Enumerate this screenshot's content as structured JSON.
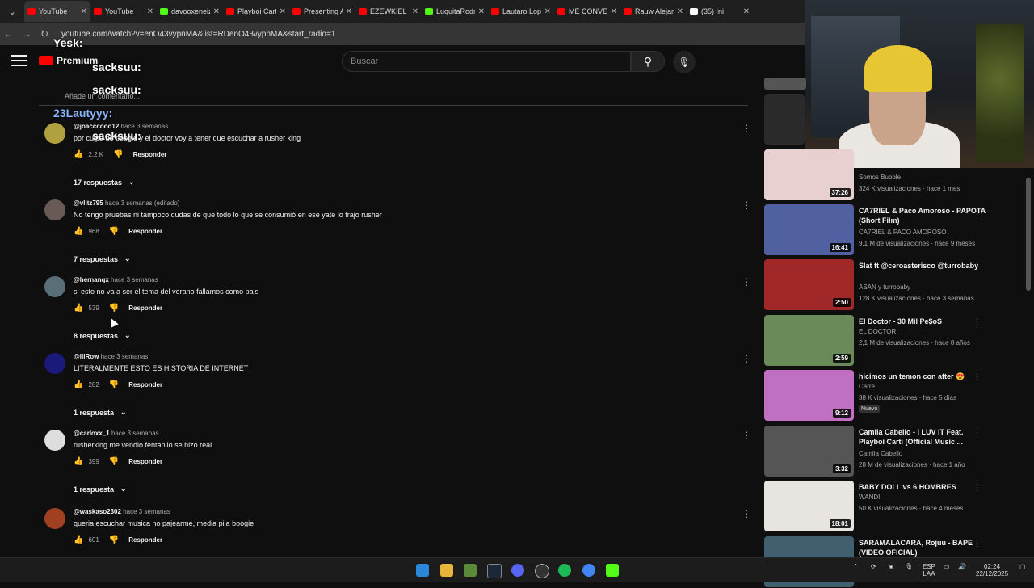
{
  "browser": {
    "tabs": [
      {
        "title": "YouTube",
        "color": "#ff0000"
      },
      {
        "title": "YouTube",
        "color": "#ff0000"
      },
      {
        "title": "davooxeneize",
        "color": "#53fc18"
      },
      {
        "title": "Playboi Carti",
        "color": "#ff0000"
      },
      {
        "title": "Presenting A",
        "color": "#ff0000"
      },
      {
        "title": "EZEWKIEL -",
        "color": "#ff0000"
      },
      {
        "title": "LuquitaRodr",
        "color": "#53fc18"
      },
      {
        "title": "Lautaro Lope",
        "color": "#ff0000"
      },
      {
        "title": "ME CONVER",
        "color": "#ff0000"
      },
      {
        "title": "Rauw Alejan",
        "color": "#ff0000"
      },
      {
        "title": "(35) Ini",
        "color": "#ffffff"
      }
    ],
    "url": "youtube.com/watch?v=enO43vypnMA&list=RDenO43vypnMA&start_radio=1"
  },
  "youtube": {
    "logo_text": "Premium",
    "search_placeholder": "Buscar",
    "add_comment_placeholder": "Añade un comentario..."
  },
  "chat_overlay": [
    {
      "user": "Yesk:",
      "color": "#ffffff"
    },
    {
      "user": "sacksuu:",
      "color": "#ffffff"
    },
    {
      "user": "sacksuu:",
      "color": "#ffffff"
    },
    {
      "user": "23Lautyyy:",
      "color": "#8ab4f8"
    },
    {
      "user": "sacksuu:",
      "color": "#ffffff"
    }
  ],
  "comments": [
    {
      "user": "@joacccooo12",
      "time": "hace 3 semanas",
      "text": "por culpa de boogie y el doctor voy a tener que escuchar a rusher king",
      "likes": "2,2 K",
      "reply": "Responder",
      "replies": "17 respuestas",
      "avatar": "#b0a040"
    },
    {
      "user": "@vlitz795",
      "time": "hace 3 semanas (editado)",
      "text": "No tengo pruebas ni tampoco dudas de que todo lo que se consumió en ese yate lo trajo rusher",
      "likes": "968",
      "reply": "Responder",
      "replies": "7 respuestas",
      "avatar": "#6a5a55"
    },
    {
      "user": "@hernanqx",
      "time": "hace 3 semanas",
      "text": "si esto no va a ser el tema del verano fallamos como pais",
      "likes": "539",
      "reply": "Responder",
      "replies": "8 respuestas",
      "avatar": "#5a6e7a"
    },
    {
      "user": "@lllRow",
      "time": "hace 3 semanas",
      "text": "LITERALMENTE ESTO ES HISTORIA DE INTERNET",
      "likes": "282",
      "reply": "Responder",
      "replies": "1 respuesta",
      "avatar": "#1a1a7a"
    },
    {
      "user": "@carloxx_1",
      "time": "hace 3 semanas",
      "text": "rusherking me vendio fentanilo se hizo real",
      "likes": "399",
      "reply": "Responder",
      "replies": "1 respuesta",
      "avatar": "#ddd"
    },
    {
      "user": "@waskaso2302",
      "time": "hace 3 semanas",
      "text": "queria escuchar musica no pajearme, media pila boogie",
      "likes": "601",
      "reply": "Responder",
      "replies": "",
      "avatar": "#a04020"
    }
  ],
  "sidebar_videos": [
    {
      "title": "",
      "channel": "Somos Bubble",
      "meta": "324 K visualizaciones · hace 1 mes",
      "duration": "37:26",
      "badge": "",
      "thumb": "#e8d0d0"
    },
    {
      "title": "CA7RIEL & Paco Amoroso - PAPOTA (Short Film)",
      "channel": "CA7RIEL & PACO AMOROSO",
      "meta": "9,1 M de visualizaciones · hace 9 meses",
      "duration": "16:41",
      "badge": "",
      "thumb": "#5060a0"
    },
    {
      "title": "Slat ft @ceroasterisco @turrobaby",
      "channel": "ASAN y turrobaby",
      "meta": "128 K visualizaciones · hace 3 semanas",
      "duration": "2:50",
      "badge": "",
      "thumb": "#a02828"
    },
    {
      "title": "El Doctor - 30 Mil Pe$oS",
      "channel": "EL DOCTOR",
      "meta": "2,1 M de visualizaciones · hace 8 años",
      "duration": "2:59",
      "badge": "",
      "thumb": "#6a8a5a"
    },
    {
      "title": "hicimos un temon con after 😍",
      "channel": "Carre",
      "meta": "38 K visualizaciones · hace 5 días",
      "duration": "9:12",
      "badge": "Nuevo",
      "thumb": "#c070c0"
    },
    {
      "title": "Camila Cabello - I LUV IT Feat. Playboi Carti (Official Music ...",
      "channel": "Camila Cabello",
      "meta": "28 M de visualizaciones · hace 1 año",
      "duration": "3:32",
      "badge": "",
      "thumb": "#555555"
    },
    {
      "title": "BABY DOLL vs 6 HOMBRES",
      "channel": "WANDII",
      "meta": "50 K visualizaciones · hace 4 meses",
      "duration": "18:01",
      "badge": "",
      "thumb": "#e8e4e0"
    },
    {
      "title": "SARAMALACARA, Rojuu - BAPE (VIDEO OFICIAL)",
      "channel": "",
      "meta": "",
      "duration": "",
      "badge": "",
      "thumb": "#406070"
    }
  ],
  "taskbar": {
    "lang_top": "ESP",
    "lang_bottom": "LAA",
    "time": "02:24",
    "date": "22/12/2025"
  }
}
